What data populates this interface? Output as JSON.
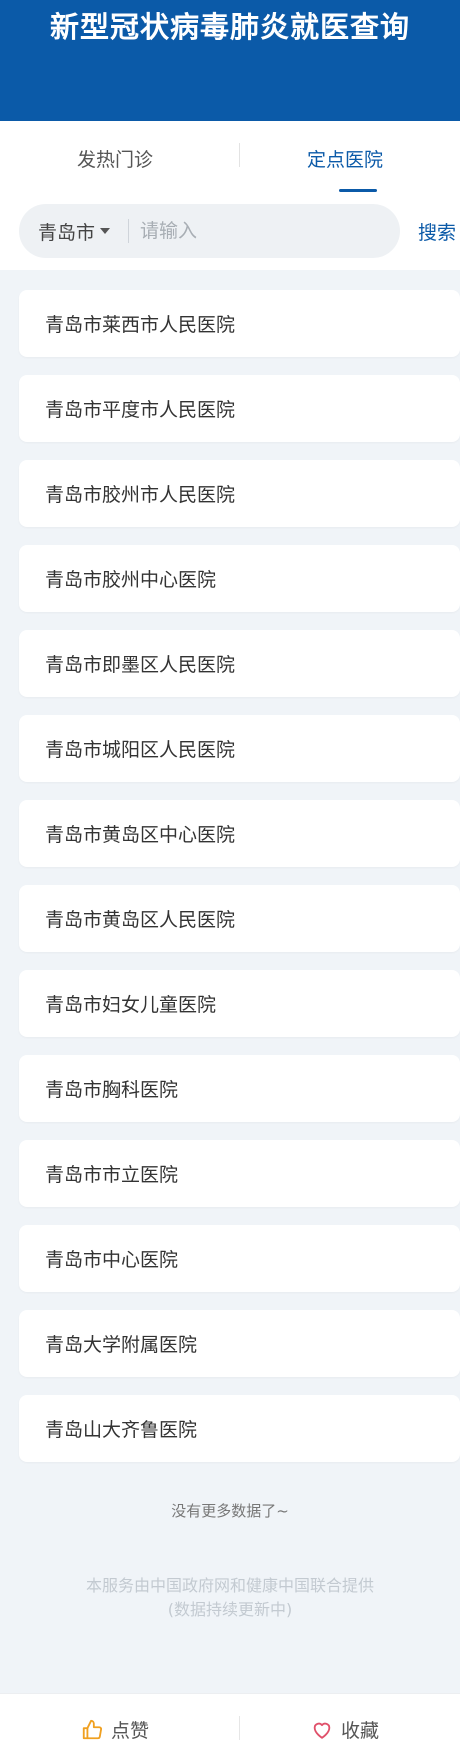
{
  "header": {
    "title": "新型冠状病毒肺炎就医查询"
  },
  "tabs": [
    {
      "label": "发热门诊",
      "active": false
    },
    {
      "label": "定点医院",
      "active": true
    }
  ],
  "search": {
    "city": "青岛市",
    "placeholder": "请输入",
    "button_label": "搜索"
  },
  "hospitals": [
    "青岛市莱西市人民医院",
    "青岛市平度市人民医院",
    "青岛市胶州市人民医院",
    "青岛市胶州中心医院",
    "青岛市即墨区人民医院",
    "青岛市城阳区人民医院",
    "青岛市黄岛区中心医院",
    "青岛市黄岛区人民医院",
    "青岛市妇女儿童医院",
    "青岛市胸科医院",
    "青岛市市立医院",
    "青岛市中心医院",
    "青岛大学附属医院",
    "青岛山大齐鲁医院"
  ],
  "list_end_text": "没有更多数据了~",
  "footer": {
    "note_line1": "本服务由中国政府网和健康中国联合提供",
    "note_line2": "(数据持续更新中)"
  },
  "bottom_bar": {
    "like_label": "点赞",
    "favorite_label": "收藏"
  },
  "colors": {
    "brand": "#0b5aa8",
    "background": "#f0f4f8",
    "like_icon": "#f0a020",
    "favorite_icon": "#e0506a"
  },
  "icons": {
    "like": "thumbs-up-icon",
    "favorite": "heart-icon",
    "dropdown": "caret-down-icon"
  }
}
